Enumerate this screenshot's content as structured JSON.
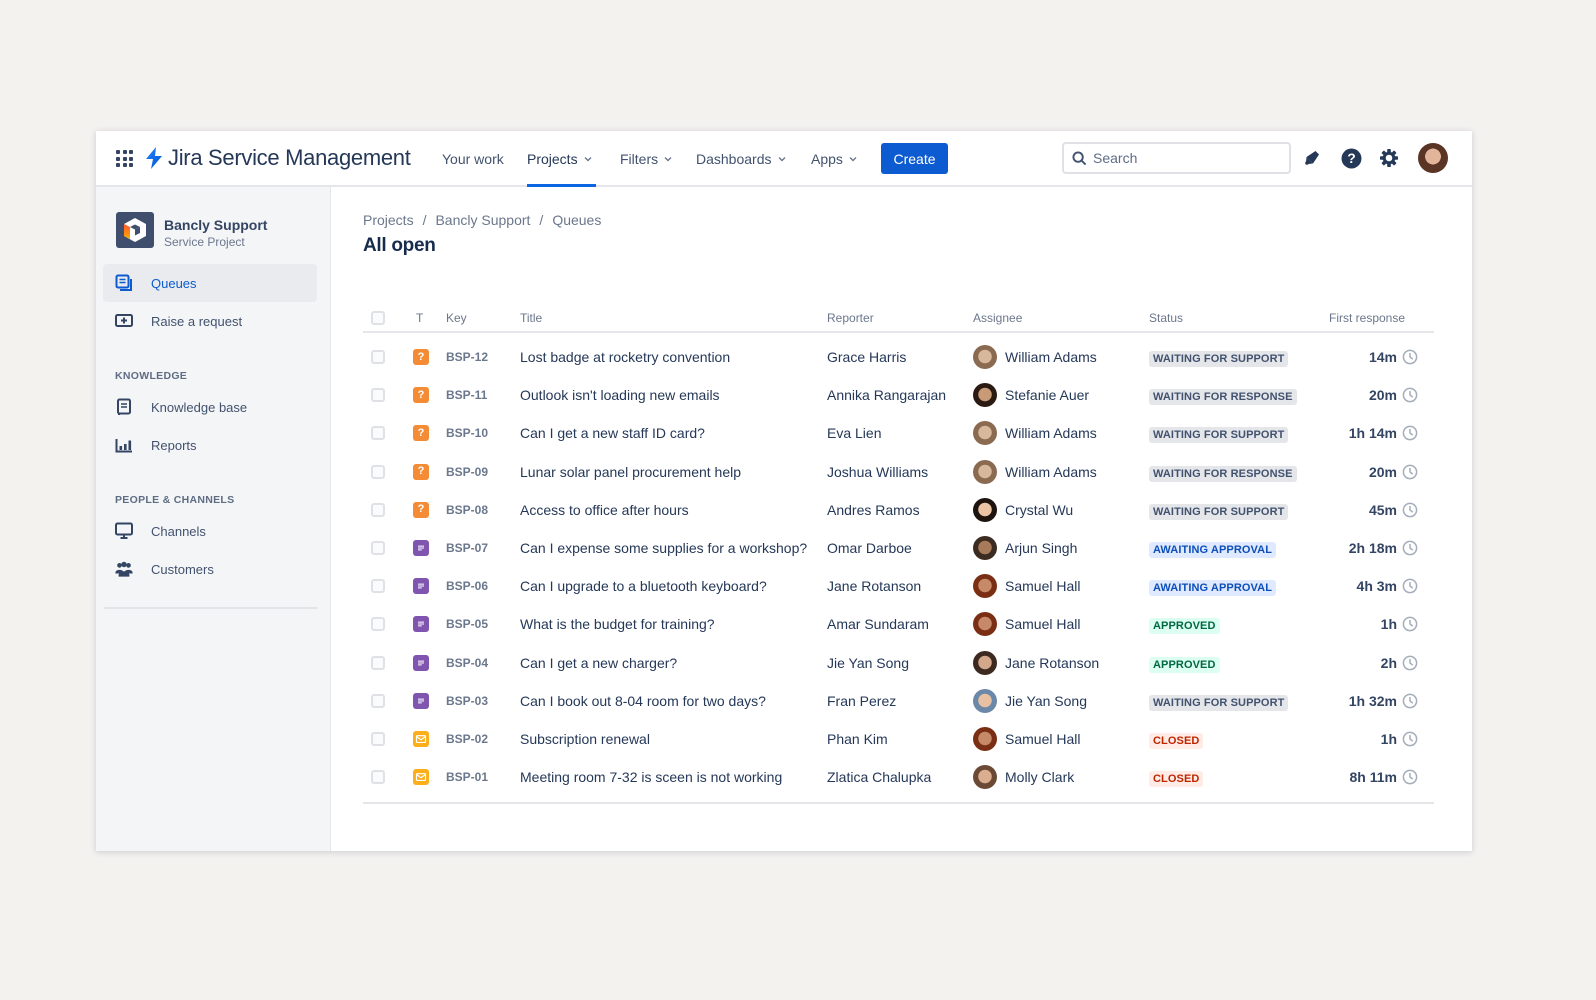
{
  "app": {
    "title": "Jira Service Management",
    "brand_color": "#0c66e4"
  },
  "topnav": {
    "items": [
      {
        "label": "Your work",
        "dropdown": false,
        "active": false
      },
      {
        "label": "Projects",
        "dropdown": true,
        "active": true
      },
      {
        "label": "Filters",
        "dropdown": true,
        "active": false
      },
      {
        "label": "Dashboards",
        "dropdown": true,
        "active": false
      },
      {
        "label": "Apps",
        "dropdown": true,
        "active": false
      }
    ],
    "create_label": "Create",
    "search_placeholder": "Search",
    "icons": [
      "notifications-icon",
      "help-icon",
      "settings-icon",
      "profile-avatar"
    ]
  },
  "sidebar": {
    "project_name": "Bancly Support",
    "project_type": "Service Project",
    "items": [
      {
        "label": "Queues",
        "icon": "queues-icon",
        "active": true
      },
      {
        "label": "Raise a request",
        "icon": "raise-request-icon",
        "active": false
      }
    ],
    "sections": [
      {
        "heading": "KNOWLEDGE",
        "items": [
          {
            "label": "Knowledge base",
            "icon": "knowledge-base-icon"
          },
          {
            "label": "Reports",
            "icon": "reports-icon"
          }
        ]
      },
      {
        "heading": "PEOPLE & CHANNELS",
        "items": [
          {
            "label": "Channels",
            "icon": "channels-icon"
          },
          {
            "label": "Customers",
            "icon": "customers-icon"
          }
        ]
      }
    ]
  },
  "main": {
    "breadcrumb": [
      "Projects",
      "Bancly Support",
      "Queues"
    ],
    "title": "All open",
    "columns": [
      "T",
      "Key",
      "Title",
      "Reporter",
      "Assignee",
      "Status",
      "First response"
    ],
    "rows": [
      {
        "type": "question",
        "key": "BSP-12",
        "title": "Lost badge at rocketry convention",
        "reporter": "Grace Harris",
        "assignee": "William Adams",
        "status": "WAITING FOR SUPPORT",
        "status_kind": "default",
        "first_response": "14m"
      },
      {
        "type": "question",
        "key": "BSP-11",
        "title": "Outlook isn't loading new emails",
        "reporter": "Annika Rangarajan",
        "assignee": "Stefanie Auer",
        "status": "WAITING FOR RESPONSE",
        "status_kind": "default",
        "first_response": "20m"
      },
      {
        "type": "question",
        "key": "BSP-10",
        "title": "Can I get a new staff ID card?",
        "reporter": "Eva Lien",
        "assignee": "William Adams",
        "status": "WAITING FOR SUPPORT",
        "status_kind": "default",
        "first_response": "1h 14m"
      },
      {
        "type": "question",
        "key": "BSP-09",
        "title": "Lunar solar panel procurement help",
        "reporter": "Joshua Williams",
        "assignee": "William Adams",
        "status": "WAITING FOR RESPONSE",
        "status_kind": "default",
        "first_response": "20m"
      },
      {
        "type": "question",
        "key": "BSP-08",
        "title": "Access to office after hours",
        "reporter": "Andres Ramos",
        "assignee": "Crystal Wu",
        "status": "WAITING FOR SUPPORT",
        "status_kind": "default",
        "first_response": "45m"
      },
      {
        "type": "request",
        "key": "BSP-07",
        "title": "Can I expense some supplies for a workshop?",
        "reporter": "Omar Darboe",
        "assignee": "Arjun Singh",
        "status": "AWAITING APPROVAL",
        "status_kind": "info",
        "first_response": "2h 18m"
      },
      {
        "type": "request",
        "key": "BSP-06",
        "title": "Can I upgrade to a bluetooth keyboard?",
        "reporter": "Jane Rotanson",
        "assignee": "Samuel Hall",
        "status": "AWAITING APPROVAL",
        "status_kind": "info",
        "first_response": "4h 3m"
      },
      {
        "type": "request",
        "key": "BSP-05",
        "title": "What is the budget for training?",
        "reporter": "Amar Sundaram",
        "assignee": "Samuel Hall",
        "status": "APPROVED",
        "status_kind": "success",
        "first_response": "1h"
      },
      {
        "type": "request",
        "key": "BSP-04",
        "title": "Can I get a new charger?",
        "reporter": "Jie Yan Song",
        "assignee": "Jane Rotanson",
        "status": "APPROVED",
        "status_kind": "success",
        "first_response": "2h"
      },
      {
        "type": "request",
        "key": "BSP-03",
        "title": "Can I book out 8-04 room for two days?",
        "reporter": "Fran Perez",
        "assignee": "Jie Yan Song",
        "status": "WAITING FOR SUPPORT",
        "status_kind": "default",
        "first_response": "1h 32m"
      },
      {
        "type": "email",
        "key": "BSP-02",
        "title": "Subscription renewal",
        "reporter": "Phan Kim",
        "assignee": "Samuel Hall",
        "status": "CLOSED",
        "status_kind": "error",
        "first_response": "1h"
      },
      {
        "type": "email",
        "key": "BSP-01",
        "title": "Meeting room 7-32 is sceen is not working",
        "reporter": "Zlatica Chalupka",
        "assignee": "Molly Clark",
        "status": "CLOSED",
        "status_kind": "error",
        "first_response": "8h 11m"
      }
    ]
  },
  "colors": {
    "question": "#f38c35",
    "request": "#8055b0",
    "email": "#fcaf1a",
    "badge_default_bg": "#e4e6ea",
    "badge_default_fg": "#42526e",
    "badge_info_bg": "#dfe9ff",
    "badge_info_fg": "#0c4fb8",
    "badge_success_bg": "#dcfff1",
    "badge_success_fg": "#006644",
    "badge_error_bg": "#ffece6",
    "badge_error_fg": "#bf2600"
  },
  "avatar_colors": {
    "William Adams": [
      "#d8b89c",
      "#8a6a50"
    ],
    "Stefanie Auer": [
      "#c99a78",
      "#2a1a12"
    ],
    "Crystal Wu": [
      "#ecc3a4",
      "#1e130e"
    ],
    "Arjun Singh": [
      "#a77a5a",
      "#3b2b20"
    ],
    "Samuel Hall": [
      "#c68a68",
      "#7a2e14"
    ],
    "Jane Rotanson": [
      "#d3a88a",
      "#3c2a20"
    ],
    "Jie Yan Song": [
      "#e8c0a2",
      "#6b88a8"
    ],
    "Molly Clark": [
      "#dcae90",
      "#6b4a35"
    ]
  }
}
